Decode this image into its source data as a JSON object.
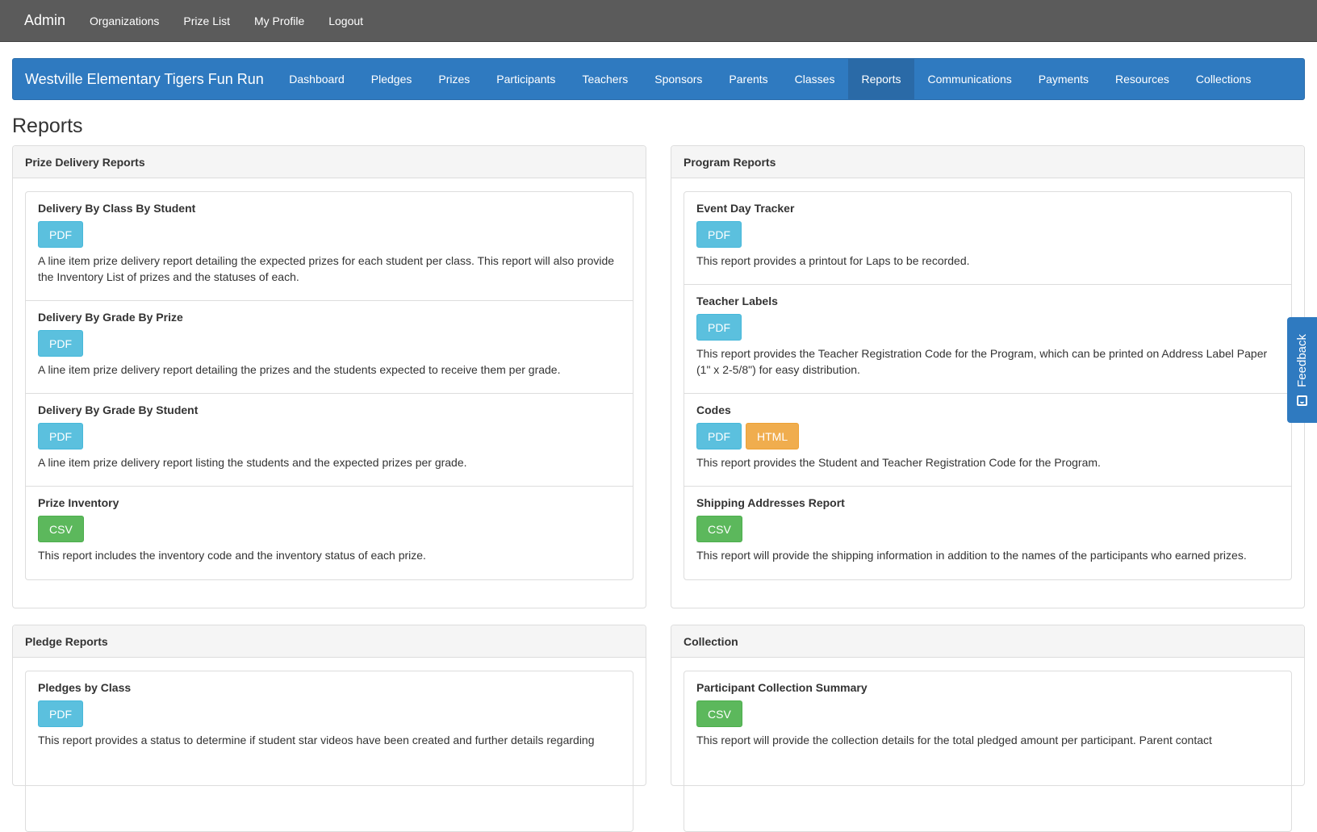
{
  "topnav": {
    "brand": "Admin",
    "links": [
      "Organizations",
      "Prize List",
      "My Profile",
      "Logout"
    ]
  },
  "program": {
    "title": "Westville Elementary Tigers Fun Run",
    "tabs": [
      "Dashboard",
      "Pledges",
      "Prizes",
      "Participants",
      "Teachers",
      "Sponsors",
      "Parents",
      "Classes",
      "Reports",
      "Communications",
      "Payments",
      "Resources",
      "Collections"
    ],
    "active_tab": "Reports"
  },
  "page": {
    "title": "Reports"
  },
  "panels": {
    "prize_delivery": {
      "heading": "Prize Delivery Reports",
      "reports": [
        {
          "title": "Delivery By Class By Student",
          "buttons": [
            "PDF"
          ],
          "desc": "A line item prize delivery report detailing the expected prizes for each student per class. This report will also provide the Inventory List of prizes and the statuses of each."
        },
        {
          "title": "Delivery By Grade By Prize",
          "buttons": [
            "PDF"
          ],
          "desc": "A line item prize delivery report detailing the prizes and the students expected to receive them per grade."
        },
        {
          "title": "Delivery By Grade By Student",
          "buttons": [
            "PDF"
          ],
          "desc": "A line item prize delivery report listing the students and the expected prizes per grade."
        },
        {
          "title": "Prize Inventory",
          "buttons": [
            "CSV"
          ],
          "desc": "This report includes the inventory code and the inventory status of each prize."
        }
      ]
    },
    "program_reports": {
      "heading": "Program Reports",
      "reports": [
        {
          "title": "Event Day Tracker",
          "buttons": [
            "PDF"
          ],
          "desc": "This report provides a printout for Laps to be recorded."
        },
        {
          "title": "Teacher Labels",
          "buttons": [
            "PDF"
          ],
          "desc": "This report provides the Teacher Registration Code for the Program, which can be printed on Address Label Paper (1\" x 2-5/8\") for easy distribution."
        },
        {
          "title": "Codes",
          "buttons": [
            "PDF",
            "HTML"
          ],
          "desc": "This report provides the Student and Teacher Registration Code for the Program."
        },
        {
          "title": "Shipping Addresses Report",
          "buttons": [
            "CSV"
          ],
          "desc": "This report will provide the shipping information in addition to the names of the participants who earned prizes."
        }
      ]
    },
    "pledge_reports": {
      "heading": "Pledge Reports",
      "reports": [
        {
          "title": "Pledges by Class",
          "buttons": [
            "PDF"
          ],
          "desc": "This report provides a status to determine if student star videos have been created and further details regarding"
        }
      ]
    },
    "collection": {
      "heading": "Collection",
      "reports": [
        {
          "title": "Participant Collection Summary",
          "buttons": [
            "CSV"
          ],
          "desc": "This report will provide the collection details for the total pledged amount per participant. Parent contact"
        }
      ]
    }
  },
  "feedback": {
    "label": "Feedback",
    "icon": "smile-icon"
  },
  "colors": {
    "topbar": "#5b5b5b",
    "program_bar": "#2f7ac0",
    "pdf": "#5bc0de",
    "csv": "#5cb85c",
    "html": "#f0ad4e"
  }
}
